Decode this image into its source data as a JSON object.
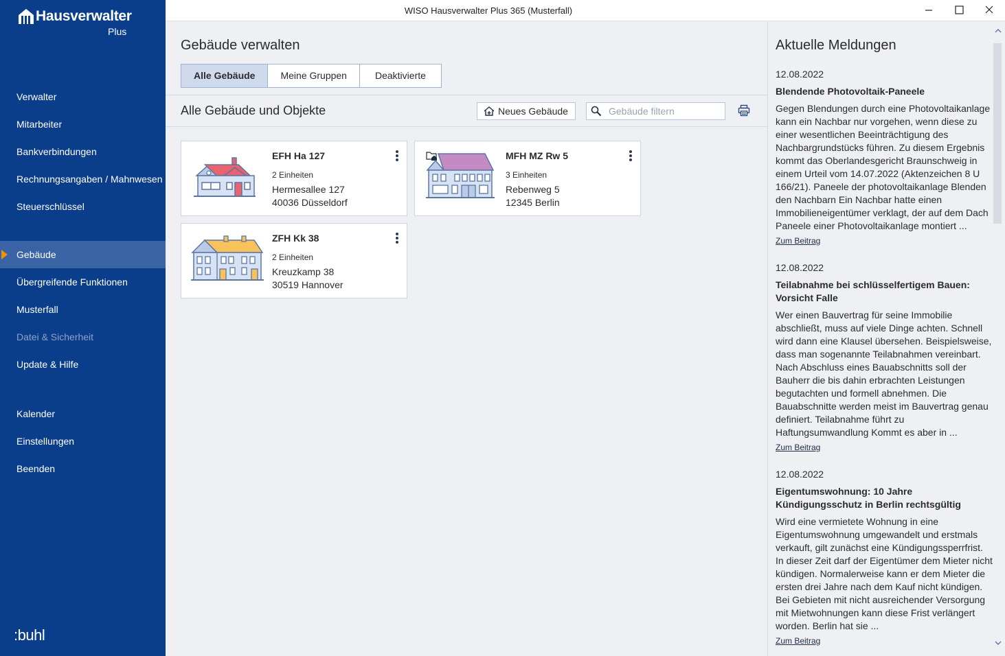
{
  "window": {
    "title": "WISO Hausverwalter Plus 365 (Musterfall)"
  },
  "brand": {
    "name": "Hausverwalter",
    "sub": "Plus",
    "footer": ":buhl"
  },
  "sidebar": {
    "group1": [
      "Verwalter",
      "Mitarbeiter",
      "Bankverbindungen",
      "Rechnungsangaben / Mahnwesen",
      "Steuerschlüssel"
    ],
    "group2": [
      "Gebäude",
      "Übergreifende Funktionen",
      "Musterfall",
      "Datei & Sicherheit",
      "Update & Hilfe"
    ],
    "group3": [
      "Kalender",
      "Einstellungen",
      "Beenden"
    ]
  },
  "main": {
    "title": "Gebäude verwalten",
    "tabs": [
      "Alle Gebäude",
      "Meine Gruppen",
      "Deaktivierte"
    ],
    "section_title": "Alle Gebäude und Objekte",
    "new_button": "Neues Gebäude",
    "search_placeholder": "Gebäude filtern",
    "buildings": [
      {
        "name": "EFH Ha 127",
        "units": "2 Einheiten",
        "street": "Hermesallee 127",
        "city": "40036 Düsseldorf",
        "roof_color": "#e8636b"
      },
      {
        "name": "MFH MZ Rw 5",
        "units": "3 Einheiten",
        "street": "Rebenweg 5",
        "city": "12345 Berlin",
        "roof_color": "#c58ac4"
      },
      {
        "name": "ZFH Kk 38",
        "units": "2 Einheiten",
        "street": "Kreuzkamp 38",
        "city": "30519 Hannover",
        "roof_color": "#f8c35a"
      }
    ]
  },
  "news": {
    "title": "Aktuelle Meldungen",
    "articles": [
      {
        "date": "12.08.2022",
        "headline": "Blendende Photovoltaik-Paneele",
        "body": "Gegen Blendungen durch eine Photovoltaikanlage kann ein Nachbar nur vorgehen, wenn diese zu einer wesentlichen Beeinträchtigung des Nachbargrundstücks führen. Zu diesem Ergebnis kommt das Oberlandesgericht Braunschweig in einem Urteil vom 14.07.2022 (Aktenzeichen 8 U 166/21). Paneele der photovoltaikanlage Blenden den Nachbarn Ein Nachbar hatte einen Immobilieneigentümer verklagt, der auf dem Dach Paneele einer Photovoltaikanlage montiert ...",
        "link": "Zum Beitrag"
      },
      {
        "date": "12.08.2022",
        "headline": "Teilabnahme bei schlüsselfertigem Bauen: Vorsicht Falle",
        "body": "Wer einen Bauvertrag für seine Immobilie abschließt, muss auf viele Dinge achten. Schnell wird dann eine Klausel übersehen. Beispielsweise, dass man sogenannte Teilabnahmen vereinbart. Nach Abschluss eines Bauabschnitts soll der Bauherr die bis dahin erbrachten Leistungen begutachten und formell abnehmen. Die Bauabschnitte werden meist im Bauvertrag genau definiert. Teilabnahme führt zu Haftungsumwandlung Kommt es aber in ...",
        "link": "Zum Beitrag"
      },
      {
        "date": "12.08.2022",
        "headline": "Eigentumswohnung: 10 Jahre Kündigungsschutz in Berlin rechtsgültig",
        "body": "Wird eine vermietete Wohnung in eine Eigentumswohnung umgewandelt und erstmals verkauft, gilt zunächst eine Kündigungssperrfrist. In dieser Zeit darf der Eigentümer dem Mieter nicht kündigen. Normalerweise kann er dem Mieter die ersten drei Jahre nach dem Kauf nicht kündigen. Bei Gebieten mit nicht ausreichender Versorgung mit Mietwohnungen kann diese Frist verlängert worden. Berlin hat sie ...",
        "link": "Zum Beitrag"
      }
    ]
  }
}
